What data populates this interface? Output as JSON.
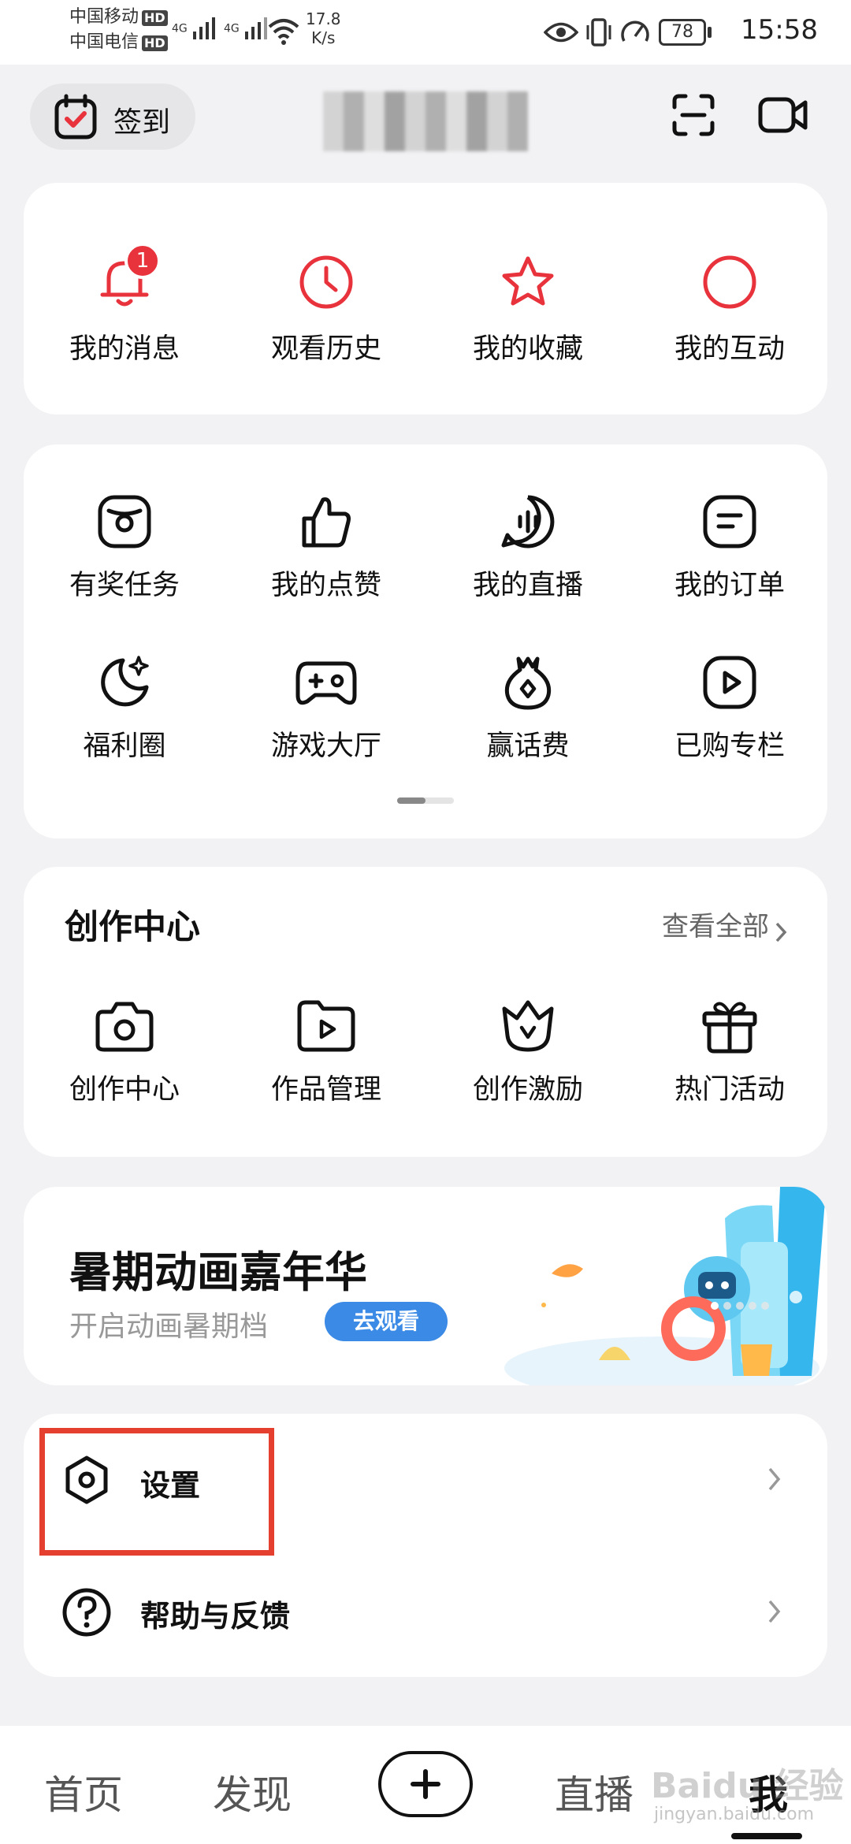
{
  "status_bar": {
    "carrier1": "中国移动",
    "carrier2": "中国电信",
    "hd": "HD",
    "net1": "4G",
    "net2": "4G",
    "speed_value": "17.8",
    "speed_unit": "K/s",
    "battery": "78",
    "time": "15:58"
  },
  "header": {
    "signin_label": "签到"
  },
  "quick_actions": [
    {
      "label": "我的消息",
      "icon": "bell-icon",
      "badge": "1"
    },
    {
      "label": "观看历史",
      "icon": "clock-icon"
    },
    {
      "label": "我的收藏",
      "icon": "star-icon"
    },
    {
      "label": "我的互动",
      "icon": "circle-icon"
    }
  ],
  "tools": [
    {
      "label": "有奖任务",
      "icon": "reward-task-icon"
    },
    {
      "label": "我的点赞",
      "icon": "thumbs-up-icon"
    },
    {
      "label": "我的直播",
      "icon": "live-icon"
    },
    {
      "label": "我的订单",
      "icon": "order-icon"
    },
    {
      "label": "福利圈",
      "icon": "moon-sparkle-icon"
    },
    {
      "label": "游戏大厅",
      "icon": "gamepad-icon"
    },
    {
      "label": "赢话费",
      "icon": "money-bag-icon"
    },
    {
      "label": "已购专栏",
      "icon": "play-square-icon"
    }
  ],
  "creator": {
    "title": "创作中心",
    "view_all": "查看全部",
    "items": [
      {
        "label": "创作中心",
        "icon": "camera-icon"
      },
      {
        "label": "作品管理",
        "icon": "folder-play-icon"
      },
      {
        "label": "创作激励",
        "icon": "crown-v-icon"
      },
      {
        "label": "热门活动",
        "icon": "gift-icon"
      }
    ]
  },
  "banner": {
    "title": "暑期动画嘉年华",
    "subtitle": "开启动画暑期档",
    "button": "去观看"
  },
  "settings": {
    "settings_label": "设置",
    "help_label": "帮助与反馈"
  },
  "tabbar": {
    "home": "首页",
    "discover": "发现",
    "live": "直播",
    "me": "我"
  },
  "watermark": "Baidu 经验",
  "watermark_url": "jingyan.baidu.com",
  "colors": {
    "accent_red": "#e8323c",
    "highlight_box": "#e5402f",
    "banner_button": "#3a8ae6"
  }
}
